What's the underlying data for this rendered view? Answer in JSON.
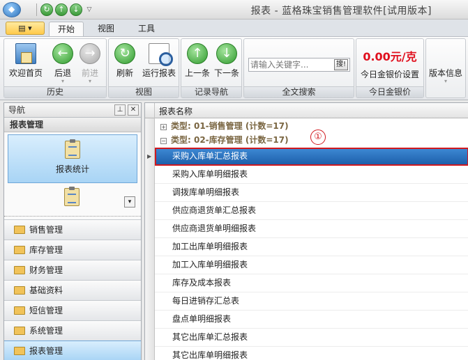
{
  "window": {
    "title": "报表 - 蓝格珠宝销售管理软件[试用版本]"
  },
  "tabs": [
    {
      "label": "开始",
      "active": true
    },
    {
      "label": "视图",
      "active": false
    },
    {
      "label": "工具",
      "active": false
    }
  ],
  "ribbon": {
    "history": {
      "label": "历史",
      "home": "欢迎首页",
      "back": "后退",
      "forward": "前进"
    },
    "view": {
      "label": "视图",
      "refresh": "刷新",
      "run_report": "运行报表"
    },
    "record_nav": {
      "label": "记录导航",
      "prev": "上一条",
      "next": "下一条"
    },
    "fulltext": {
      "label": "全文搜索",
      "placeholder": "请输入关键字...",
      "button": "搜!"
    },
    "gold": {
      "label": "今日金银价",
      "price": "0.00元/克",
      "settings": "今日金银价设置"
    },
    "version": {
      "label": "版本信息"
    }
  },
  "nav": {
    "header": "导航",
    "section": "报表管理",
    "big_item": "报表统计",
    "items": [
      {
        "label": "销售管理",
        "active": false
      },
      {
        "label": "库存管理",
        "active": false
      },
      {
        "label": "财务管理",
        "active": false
      },
      {
        "label": "基础资料",
        "active": false
      },
      {
        "label": "短信管理",
        "active": false
      },
      {
        "label": "系统管理",
        "active": false
      },
      {
        "label": "报表管理",
        "active": true
      }
    ]
  },
  "grid": {
    "column": "报表名称",
    "groups": [
      {
        "label": "类型: 01-销售管理 (计数=17)",
        "expanded": false
      },
      {
        "label": "类型: 02-库存管理 (计数=17)",
        "expanded": true
      }
    ],
    "rows": [
      "采购入库单汇总报表",
      "采购入库单明细报表",
      "调拨库单明细报表",
      "供应商退货单汇总报表",
      "供应商退货单明细报表",
      "加工出库单明细报表",
      "加工入库单明细报表",
      "库存及成本报表",
      "每日进销存汇总表",
      "盘点单明细报表",
      "其它出库单汇总报表",
      "其它出库单明细报表"
    ],
    "selected_index": 0,
    "annotation": "①"
  },
  "colors": {
    "selection": "#1c5ea9",
    "highlight_border": "#d0181e",
    "gold_price": "#e0101e",
    "group_text": "#7a6642"
  }
}
